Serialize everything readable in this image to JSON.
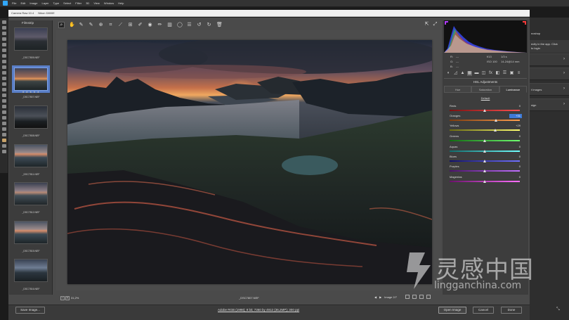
{
  "menubar": {
    "items": [
      "File",
      "Edit",
      "Image",
      "Layer",
      "Type",
      "Select",
      "Filter",
      "3D",
      "View",
      "Window",
      "Help"
    ]
  },
  "title": {
    "app": "Camera Raw 10.4",
    "camera": "Nikon D800E"
  },
  "filmstrip": {
    "title": "Filmstrip",
    "items": [
      {
        "label": "_DSC7805.NEF"
      },
      {
        "label": "_DSC7807.NEF",
        "stars": "★ ★ ★ ★ ★"
      },
      {
        "label": "_DSC7808.NEF"
      },
      {
        "label": "_DSC7811.NEF"
      },
      {
        "label": "_DSC7812.NEF"
      },
      {
        "label": "_DSC7815.NEF"
      },
      {
        "label": "_DSC7816.NEF"
      }
    ]
  },
  "preview": {
    "zoom": "31,2%",
    "filename": "_DSC7807.NEF",
    "image_count": "Image 2/7"
  },
  "info": {
    "r": "R:",
    "g": "G:",
    "b": "B:",
    "r_val": "---",
    "g_val": "---",
    "b_val": "---",
    "aperture": "f/13",
    "shutter": "1/3 s",
    "iso": "ISO 100",
    "lens": "14-24@14 mm"
  },
  "panel": {
    "title": "HSL Adjustments",
    "tabs": [
      "Hue",
      "Saturation",
      "Luminance"
    ],
    "active_tab": "Luminance",
    "default_label": "Default",
    "sliders": [
      {
        "label": "Reds",
        "value": "0",
        "pos": 0.5
      },
      {
        "label": "Oranges",
        "value": "+31",
        "pos": 0.655
      },
      {
        "label": "Yellows",
        "value": "+29",
        "pos": 0.645
      },
      {
        "label": "Greens",
        "value": "0",
        "pos": 0.5
      },
      {
        "label": "Aquas",
        "value": "0",
        "pos": 0.5
      },
      {
        "label": "Blues",
        "value": "0",
        "pos": 0.5
      },
      {
        "label": "Purples",
        "value": "0",
        "pos": 0.5
      },
      {
        "label": "Magentas",
        "value": "0",
        "pos": 0.5
      }
    ]
  },
  "ps_right": {
    "rows": [
      "noshop",
      "ectly in the app. Click",
      "to login",
      "",
      "",
      "t Images",
      "sign"
    ]
  },
  "bottom": {
    "save_label": "Save Image...",
    "workflow": "Adobe RGB (1998); 8 bit; 7360 by 4912 (36,2MP); 300 ppi",
    "open_label": "Open Image",
    "cancel_label": "Cancel",
    "done_label": "Done"
  },
  "watermark": {
    "cn": "灵感中国",
    "url": "lingganchina.com"
  },
  "colors": {
    "accent": "#3d7ad6",
    "selection": "#5a7fc7"
  }
}
